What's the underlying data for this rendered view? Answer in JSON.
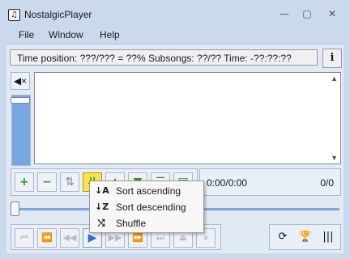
{
  "window": {
    "title": "NostalgicPlayer",
    "app_icon": "♫",
    "minimize": "—",
    "maximize": "▢",
    "close": "✕"
  },
  "menu": [
    "File",
    "Window",
    "Help"
  ],
  "info": {
    "text": "Time position: ???/??? = ??% Subsongs: ??/?? Time: -??:??:??",
    "button": "i"
  },
  "controls": {
    "mute_glyph": "◀×"
  },
  "toolbar": {
    "add": "+",
    "remove": "−",
    "swap": "⇅",
    "sort": "⇊",
    "up": "▲",
    "down": "▼",
    "select_all": "☰",
    "save": "▤"
  },
  "status": {
    "time": "0:00/0:00",
    "count": "0/0"
  },
  "transport": {
    "prev_module": "⏮",
    "prev_song": "⏪",
    "rewind": "◀◀",
    "play": "▶",
    "forward": "▶▶",
    "next_song": "⏩",
    "next_module": "⏭",
    "eject": "⏏",
    "pause": "⏸"
  },
  "aux": {
    "loop": "⟳",
    "trophy": "🏆",
    "sample": "|||"
  },
  "sort_menu": [
    {
      "icon": "↓A",
      "label": "Sort ascending"
    },
    {
      "icon": "↓Z",
      "label": "Sort descending"
    },
    {
      "icon": "⤭",
      "label": "Shuffle"
    }
  ],
  "colors": {
    "title_bg": "#cbd9ec",
    "client_bg": "#e1e9f4",
    "accent_blue": "#7aa6e0",
    "active_yellow": "#f6e44a",
    "add_green": "#2a9a2a"
  }
}
